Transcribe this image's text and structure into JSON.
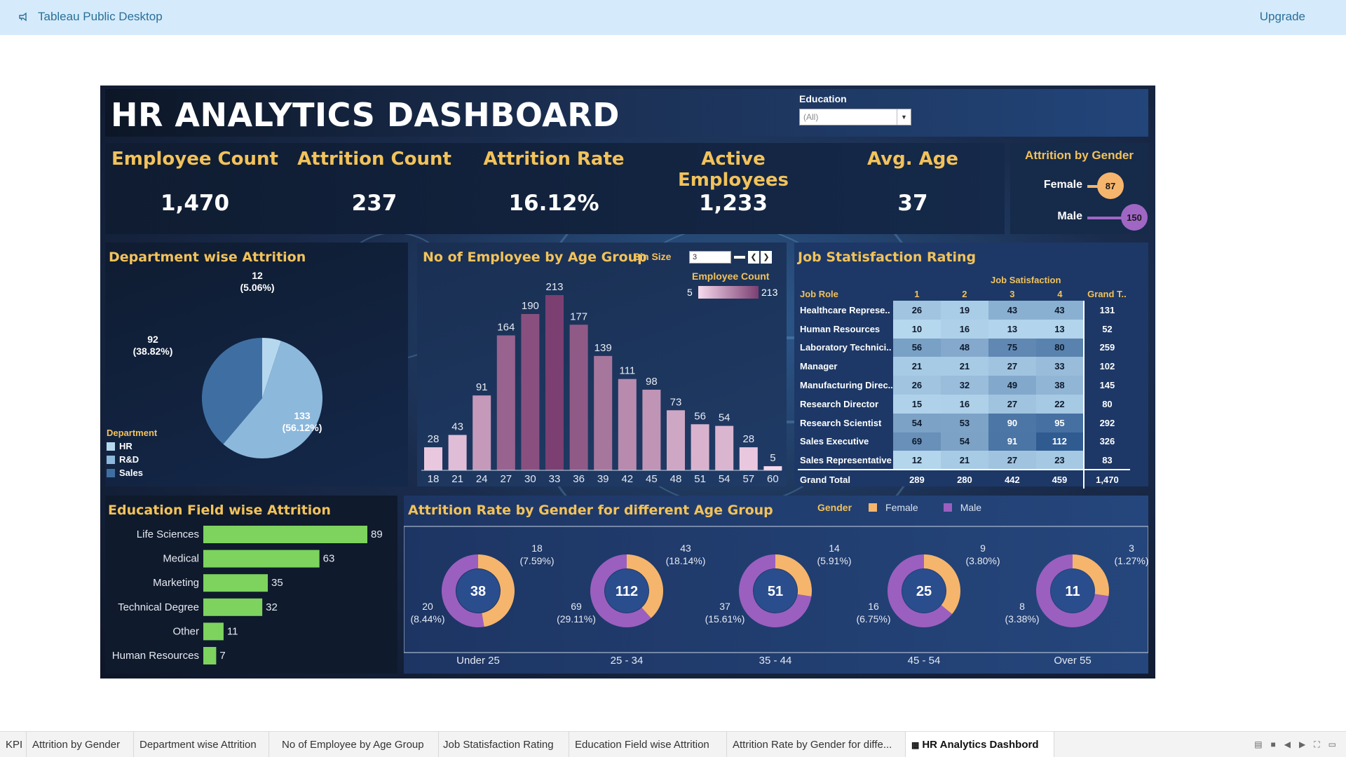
{
  "app": {
    "title": "Tableau Public Desktop",
    "upgrade": "Upgrade"
  },
  "dashboard": {
    "title": "HR ANALYTICS DASHBOARD",
    "filter": {
      "label": "Education",
      "value": "(All)"
    },
    "kpis": [
      {
        "label": "Employee Count",
        "value": "1,470"
      },
      {
        "label": "Attrition Count",
        "value": "237"
      },
      {
        "label": "Attrition Rate",
        "value": "16.12%"
      },
      {
        "label": "Active Employees",
        "value": "1,233"
      },
      {
        "label": "Avg. Age",
        "value": "37"
      }
    ],
    "gender": {
      "title": "Attrition by Gender",
      "rows": [
        {
          "label": "Female",
          "value": "87",
          "color": "#f6b56c"
        },
        {
          "label": "Male",
          "value": "150",
          "color": "#a066c4"
        }
      ]
    },
    "dept": {
      "title": "Department wise Attrition",
      "legend_title": "Department",
      "legend": [
        {
          "label": "HR",
          "color": "#b6d8ef"
        },
        {
          "label": "R&D",
          "color": "#8cb8dc"
        },
        {
          "label": "Sales",
          "color": "#3f6fa2"
        }
      ],
      "labels": [
        {
          "count": "12",
          "pct": "(5.06%)"
        },
        {
          "count": "133",
          "pct": "(56.12%)"
        },
        {
          "count": "92",
          "pct": "(38.82%)"
        }
      ]
    },
    "age": {
      "title": "No of Employee by Age Group",
      "bin_label": "Bin Size",
      "bin_value": "3",
      "legend_title": "Employee Count",
      "legend_min": "5",
      "legend_max": "213"
    },
    "job": {
      "title": "Job Statisfaction Rating",
      "col_group": "Job Satisfaction",
      "row_header": "Job Role",
      "cols": [
        "1",
        "2",
        "3",
        "4"
      ],
      "grand_header": "Grand T..",
      "rows": [
        {
          "role": "Healthcare Represe..",
          "v": [
            "26",
            "19",
            "43",
            "43"
          ],
          "t": "131"
        },
        {
          "role": "Human Resources",
          "v": [
            "10",
            "16",
            "13",
            "13"
          ],
          "t": "52"
        },
        {
          "role": "Laboratory Technici..",
          "v": [
            "56",
            "48",
            "75",
            "80"
          ],
          "t": "259"
        },
        {
          "role": "Manager",
          "v": [
            "21",
            "21",
            "27",
            "33"
          ],
          "t": "102"
        },
        {
          "role": "Manufacturing Direc..",
          "v": [
            "26",
            "32",
            "49",
            "38"
          ],
          "t": "145"
        },
        {
          "role": "Research Director",
          "v": [
            "15",
            "16",
            "27",
            "22"
          ],
          "t": "80"
        },
        {
          "role": "Research Scientist",
          "v": [
            "54",
            "53",
            "90",
            "95"
          ],
          "t": "292"
        },
        {
          "role": "Sales Executive",
          "v": [
            "69",
            "54",
            "91",
            "112"
          ],
          "t": "326"
        },
        {
          "role": "Sales Representative",
          "v": [
            "12",
            "21",
            "27",
            "23"
          ],
          "t": "83"
        }
      ],
      "total": {
        "role": "Grand Total",
        "v": [
          "289",
          "280",
          "442",
          "459"
        ],
        "t": "1,470"
      }
    },
    "eduf": {
      "title": "Education Field wise Attrition"
    },
    "arg": {
      "title": "Attrition Rate by Gender for different Age Group",
      "legend_title": "Gender",
      "legend": [
        {
          "label": "Female",
          "color": "#f6b56c"
        },
        {
          "label": "Male",
          "color": "#9b5fc0"
        }
      ]
    }
  },
  "chart_data": [
    {
      "type": "pie",
      "title": "Department wise Attrition",
      "categories": [
        "HR",
        "R&D",
        "Sales"
      ],
      "values": [
        12,
        133,
        92
      ],
      "percents": [
        "5.06%",
        "56.12%",
        "38.82%"
      ],
      "legend_position": "bottom-left"
    },
    {
      "type": "bar",
      "title": "No of Employee by Age Group",
      "categories": [
        "18",
        "21",
        "24",
        "27",
        "30",
        "33",
        "36",
        "39",
        "42",
        "45",
        "48",
        "51",
        "54",
        "57",
        "60"
      ],
      "values": [
        28,
        43,
        91,
        164,
        190,
        213,
        177,
        139,
        111,
        98,
        73,
        56,
        54,
        28,
        5
      ],
      "color_scale": {
        "min": 5,
        "max": 213,
        "from": "#f7d9ec",
        "to": "#7b3f72"
      }
    },
    {
      "type": "bar",
      "orientation": "horizontal",
      "title": "Education Field wise Attrition",
      "categories": [
        "Life Sciences",
        "Medical",
        "Marketing",
        "Technical Degree",
        "Other",
        "Human Resources"
      ],
      "values": [
        89,
        63,
        35,
        32,
        11,
        7
      ],
      "color": "#7dd35e"
    },
    {
      "type": "pie",
      "subtype": "donut",
      "title": "Attrition Rate by Gender for different Age Group",
      "categories": [
        "Under 25",
        "25 - 34",
        "35 - 44",
        "45 - 54",
        "Over 55"
      ],
      "series": [
        {
          "name": "Female",
          "values": [
            18,
            43,
            14,
            9,
            3
          ],
          "labels": [
            "(7.59%)",
            "(18.14%)",
            "(5.91%)",
            "(3.80%)",
            "(1.27%)"
          ]
        },
        {
          "name": "Male",
          "values": [
            20,
            69,
            37,
            16,
            8
          ],
          "labels": [
            "(8.44%)",
            "(29.11%)",
            "(15.61%)",
            "(6.75%)",
            "(3.38%)"
          ]
        }
      ],
      "totals": [
        38,
        112,
        51,
        25,
        11
      ]
    }
  ],
  "tabs": [
    {
      "label": "KPI"
    },
    {
      "label": "Attrition by Gender"
    },
    {
      "label": "Department wise Attrition"
    },
    {
      "label": "No of Employee by Age Group"
    },
    {
      "label": "Job Statisfaction Rating"
    },
    {
      "label": "Education Field wise Attrition"
    },
    {
      "label": "Attrition Rate by Gender for diffe..."
    },
    {
      "label": "HR Analytics Dashbord",
      "active": true
    }
  ]
}
